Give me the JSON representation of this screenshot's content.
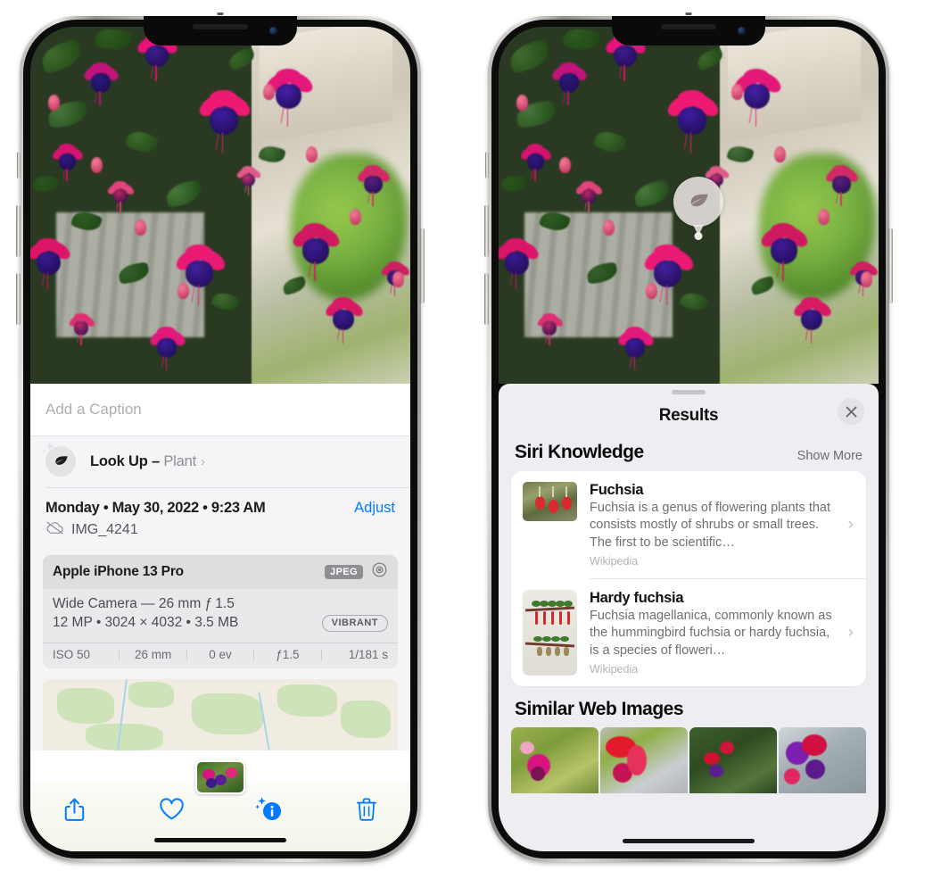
{
  "left_phone": {
    "name": "photos-detail-view",
    "caption": {
      "placeholder": "Add a Caption",
      "value": ""
    },
    "lookup": {
      "label_bold": "Look Up – ",
      "label_plain": "Plant",
      "chevron": "›",
      "icon": "leaf-icon",
      "sparkle_icon": "sparkles-icon"
    },
    "meta": {
      "date": "Monday • May 30, 2022 • 9:23 AM",
      "adjust_label": "Adjust",
      "filename": "IMG_4241",
      "cloud_icon": "icloud-slash-icon"
    },
    "exif": {
      "device": "Apple iPhone 13 Pro",
      "format_chip": "JPEG",
      "lens_icon": "aperture-icon",
      "lens_line": "Wide Camera — 26 mm ƒ 1.5",
      "size_line": "12 MP • 3024 × 4032 • 3.5 MB",
      "style_chip": "VIBRANT",
      "stats": [
        "ISO 50",
        "26 mm",
        "0 ev",
        "ƒ1.5",
        "1/181 s"
      ]
    },
    "toolbar": [
      {
        "name": "share-button",
        "icon": "share-icon"
      },
      {
        "name": "favorite-button",
        "icon": "heart-icon"
      },
      {
        "name": "info-button",
        "icon": "info-sparkle-icon"
      },
      {
        "name": "delete-button",
        "icon": "trash-icon"
      }
    ]
  },
  "right_phone": {
    "name": "visual-lookup-results",
    "photo_tag": {
      "icon": "leaf-icon",
      "label": "plant-subject-indicator"
    },
    "sheet": {
      "title": "Results",
      "close_icon": "close-icon",
      "grabber": "drag-handle"
    },
    "siri_knowledge": {
      "section_title": "Siri Knowledge",
      "show_more": "Show More",
      "items": [
        {
          "title": "Fuchsia",
          "description": "Fuchsia is a genus of flowering plants that consists mostly of shrubs or small trees. The first to be scientific…",
          "source": "Wikipedia",
          "chevron": "›",
          "thumb": "fuchsia-red-flowers-thumbnail"
        },
        {
          "title": "Hardy fuchsia",
          "description": "Fuchsia magellanica, commonly known as the hummingbird fuchsia or hardy fuchsia, is a species of floweri…",
          "source": "Wikipedia",
          "chevron": "›",
          "thumb": "hardy-fuchsia-specimen-thumbnail"
        }
      ]
    },
    "similar_web_images": {
      "section_title": "Similar Web Images",
      "tiles": [
        "fuchsia-pink-white-bloom",
        "fuchsia-red-closeup",
        "fuchsia-shrub-garden",
        "fuchsia-purple-magenta-cluster"
      ]
    }
  },
  "colors": {
    "accent_blue": "#027aff",
    "sheet_bg": "#eeeef2",
    "card_bg": "#ffffff",
    "secondary_text": "#8e8e93",
    "exif_bg": "#e9e9ec"
  }
}
